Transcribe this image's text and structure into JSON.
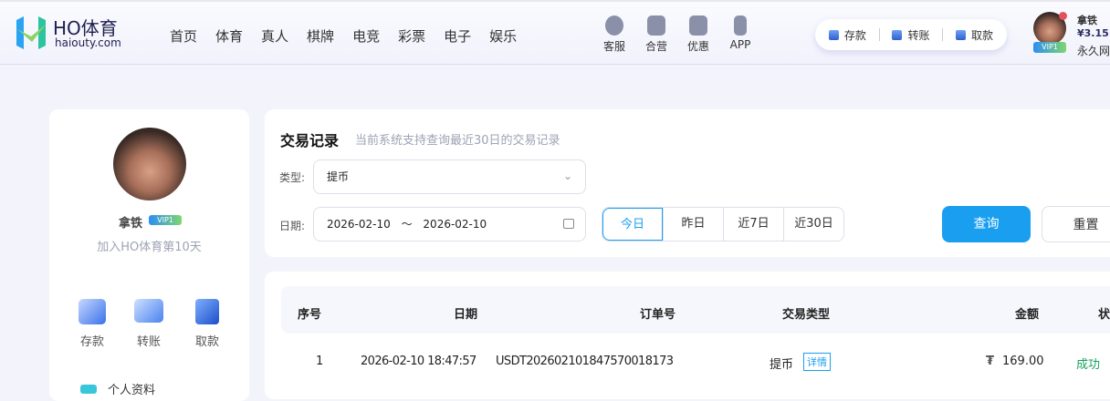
{
  "header": {
    "brand": "HO体育",
    "brand_sub": "haiouty.com",
    "nav": [
      "首页",
      "体育",
      "真人",
      "棋牌",
      "电竞",
      "彩票",
      "电子",
      "娱乐"
    ],
    "quick": [
      {
        "label": "客服",
        "icon": "headset-icon"
      },
      {
        "label": "合营",
        "icon": "handshake-icon"
      },
      {
        "label": "优惠",
        "icon": "coupon-icon"
      },
      {
        "label": "APP",
        "icon": "phone-icon"
      }
    ],
    "wallet": [
      "存款",
      "转账",
      "取款"
    ],
    "user": {
      "name": "拿铁",
      "balance": "¥3.15",
      "vip": "VIP1",
      "extra": "永久网"
    }
  },
  "profile": {
    "name": "拿铁",
    "vip": "VIP1",
    "joined": "加入HO体育第10天",
    "actions": [
      "存款",
      "转账",
      "取款"
    ],
    "menu_first": "个人资料"
  },
  "records": {
    "title": "交易记录",
    "subtitle": "当前系统支持查询最近30日的交易记录",
    "type_label": "类型:",
    "type_value": "提币",
    "date_label": "日期:",
    "date_from": "2026-02-10",
    "date_sep": "〜",
    "date_to": "2026-02-10",
    "ranges": [
      "今日",
      "昨日",
      "近7日",
      "近30日"
    ],
    "query": "查询",
    "reset": "重置",
    "columns": [
      "序号",
      "日期",
      "订单号",
      "交易类型",
      "金额",
      "状"
    ],
    "rows": [
      {
        "no": "1",
        "date": "2026-02-10 18:47:57",
        "order": "USDT20260210184757001817 3",
        "type": "提币",
        "detail": "详情",
        "currency": "₮",
        "amount": "169.00",
        "status": "成功"
      }
    ]
  },
  "colors": {
    "accent": "#1a9ff0",
    "success": "#17a05d"
  }
}
